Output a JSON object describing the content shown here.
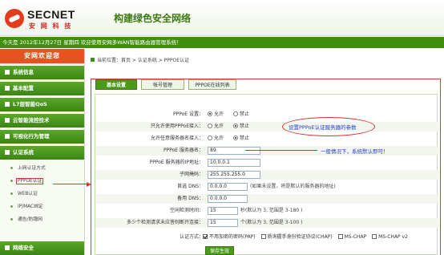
{
  "header": {
    "brand": "SECNET",
    "brand_cn": "安 网 科 技",
    "slogan": "构建绿色安全网络"
  },
  "welcome_bar": "今天是 2012年12月27日 星期四 欢迎使用安网多WAN智能路由器管理系统！",
  "sidebar": {
    "title": "安网欢迎您",
    "menu": [
      {
        "label": "系统信息"
      },
      {
        "label": "基本配置"
      },
      {
        "label": "L7层智能QoS"
      },
      {
        "label": "云智能流控技术"
      },
      {
        "label": "可视化行为管理"
      },
      {
        "label": "认证系统"
      }
    ],
    "sub_items": [
      {
        "label": "上网认证方式"
      },
      {
        "label": "PPPOE认证"
      },
      {
        "label": "WEB认证"
      },
      {
        "label": "IP/MAC绑定"
      },
      {
        "label": "通告/防蹭网"
      }
    ],
    "bottom_menu": "网络安全"
  },
  "breadcrumb": "当前位置：首页 > 认证系统 > PPPOE认证",
  "tabs": [
    {
      "label": "基本设置"
    },
    {
      "label": "帐号管理"
    },
    {
      "label": "PPPOE在线列表"
    }
  ],
  "form": {
    "pppoe_setting": {
      "label": "PPPoE 设置：",
      "opt_on": "允许",
      "opt_off": "禁止"
    },
    "only_pppoe": {
      "label": "只允许使用PPPoE接入：",
      "opt_on": "允许",
      "opt_off": "禁止"
    },
    "allow_any": {
      "label": "允许任意服务器名接入：",
      "opt_on": "允许",
      "opt_off": "禁止"
    },
    "server_name": {
      "label": "PPPoE 服务器名：",
      "value": "89"
    },
    "server_ip": {
      "label": "PPPoE 服务器的IP地址：",
      "value": "10.0.0.1"
    },
    "subnet_mask": {
      "label": "子网掩码：",
      "value": "255.255.255.0"
    },
    "primary_dns": {
      "label": "首选 DNS：",
      "value": "0.0.0.0",
      "hint": "(如果未设置，将是默认的服务器的地址)"
    },
    "backup_dns": {
      "label": "备用 DNS：",
      "value": "0.0.0.0"
    },
    "idle_time": {
      "label": "空闲检测时间：",
      "value": "15",
      "hint": "秒(默认为 3, 范围是 3-180 )"
    },
    "max_requests": {
      "label": "多少个检测请求未应答则断开连接：",
      "value": "15",
      "hint": "个(默认为 3, 范围是 3-100 )"
    },
    "auth_method": {
      "label": "认证方式：",
      "options": [
        "不用加密的密码(PAP)",
        "质询握手身份验证协议(CHAP)",
        "MS-CHAP",
        "MS-CHAP v2"
      ]
    }
  },
  "annotations": {
    "callout": "设置PPPoE认证服务器的参数",
    "note": "一般情况下，系统默认即可！"
  },
  "save_button": "保存生效",
  "colors": {
    "brand_green": "#3f8f0f",
    "accent_red": "#e23535",
    "orange": "#e8521f",
    "note_blue": "#1f3fc9"
  }
}
